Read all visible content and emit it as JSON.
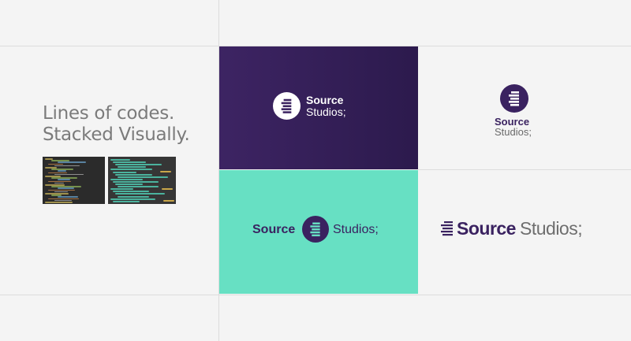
{
  "tagline": {
    "line1": "Lines of codes.",
    "line2": "Stacked Visually."
  },
  "brand": {
    "word1": "Source",
    "word2": "Studios;",
    "primary_color": "#3a2260",
    "mint_color": "#67e0c3",
    "gray_text": "#6e6e6e"
  },
  "logos": {
    "purple_tile": {
      "source": "Source",
      "studios": "Studios;"
    },
    "white_stacked": {
      "source": "Source",
      "studios": "Studios;"
    },
    "mint_tile": {
      "source": "Source",
      "studios": "Studios;"
    },
    "horizontal": {
      "source": "Source",
      "studios": "Studios;"
    }
  },
  "icons": {
    "logo_mark": "stacked-lines-icon",
    "thumb_left": "code-editor-screenshot",
    "thumb_right": "stacked-code-lines-preview"
  }
}
